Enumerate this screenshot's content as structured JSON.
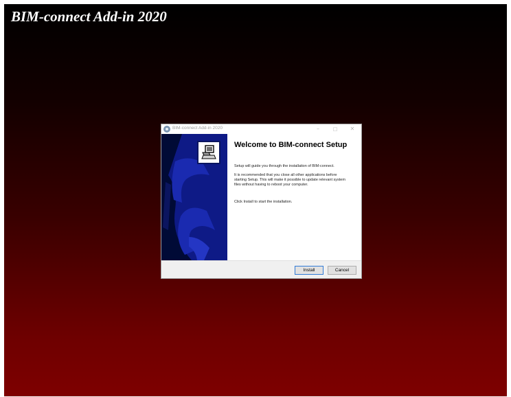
{
  "background": {
    "title": "BIM-connect Add-in 2020",
    "gradient_top": "#000000",
    "gradient_bottom": "#7e0000"
  },
  "dialog": {
    "title": "BIM-connect Add-in 2020",
    "window_controls": {
      "minimize": "–",
      "maximize": "□",
      "close": "✕"
    },
    "heading": "Welcome to BIM-connect Setup",
    "paragraphs": [
      "Setup will guide you through the installation of BIM-connect.",
      "It is recommended that you close all other applications before starting Setup. This will make it possible to update relevant system files without having to reboot your computer.",
      "Click Install to start the installation."
    ],
    "buttons": {
      "install": "Install",
      "cancel": "Cancel"
    },
    "banner_color": "#000a36",
    "accent": "#1a2ab0"
  }
}
